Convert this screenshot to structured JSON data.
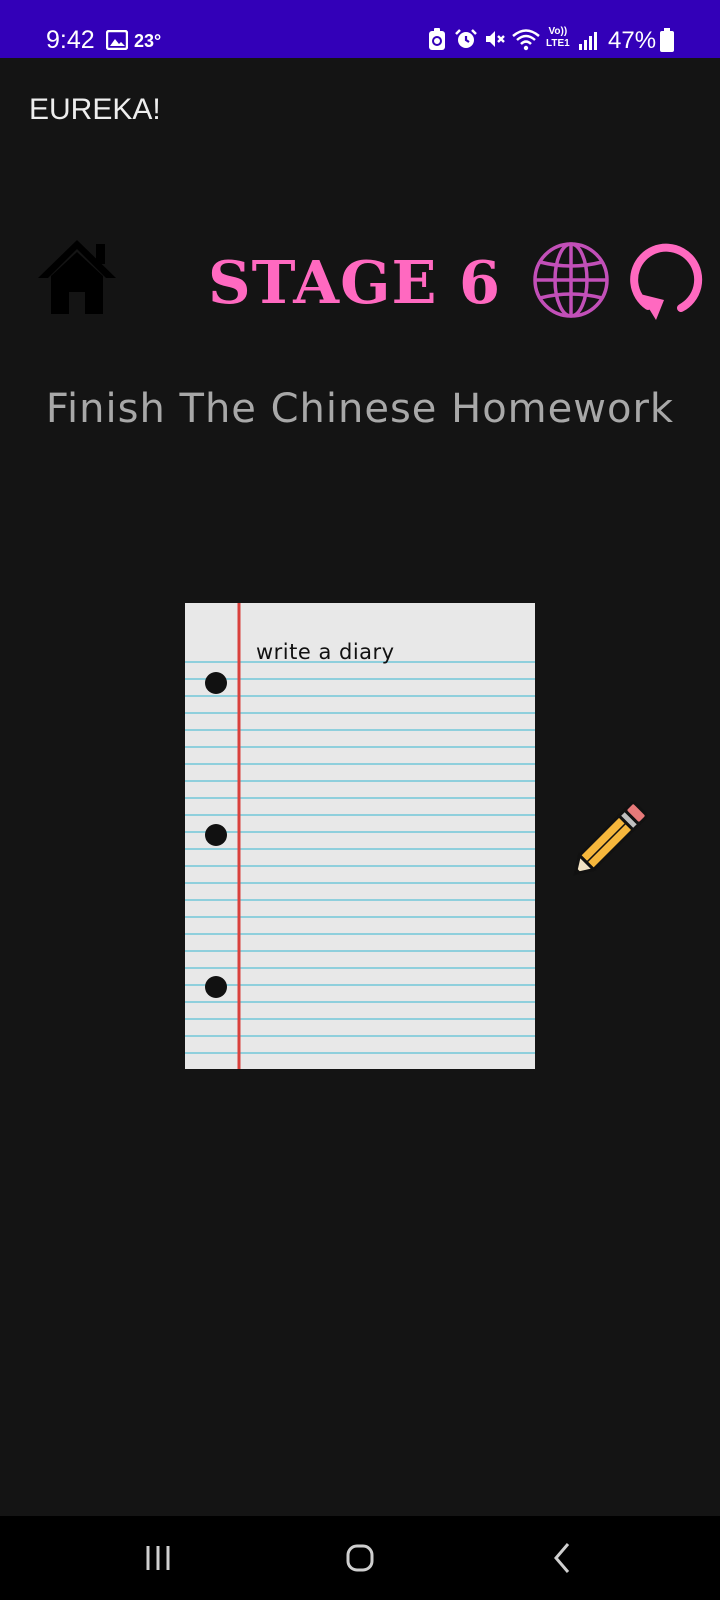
{
  "status_bar": {
    "time": "9:42",
    "temperature": "23°",
    "network_label_top": "Vo))",
    "network_label_bottom": "LTE1",
    "battery": "47%",
    "icons": [
      "photo-icon",
      "battery-saver-icon",
      "alarm-icon",
      "mute-icon",
      "wifi-icon",
      "volte-icon",
      "signal-icon",
      "battery-icon"
    ]
  },
  "app": {
    "title": "EUREKA!"
  },
  "toolbar": {
    "stage_label": "STAGE 6",
    "icons": [
      "home-icon",
      "globe-icon",
      "restart-icon"
    ]
  },
  "puzzle": {
    "title": "Finish The Chinese Homework",
    "paper_text": "write a diary",
    "items": [
      "notebook-paper",
      "pencil-icon"
    ]
  },
  "nav_bar": {
    "icons": [
      "recent-apps-icon",
      "home-button-icon",
      "back-icon"
    ]
  },
  "colors": {
    "status_bar": "#3300b8",
    "background": "#141414",
    "accent_pink": "#ff69c0",
    "globe_purple": "#c24fb8",
    "title_gray": "#a8a8a8",
    "paper": "#e8e8e8",
    "paper_lines": "#8fcfdc",
    "paper_margin": "#d9403c",
    "pencil_body": "#f6b73c",
    "pencil_eraser": "#e77a7a"
  }
}
